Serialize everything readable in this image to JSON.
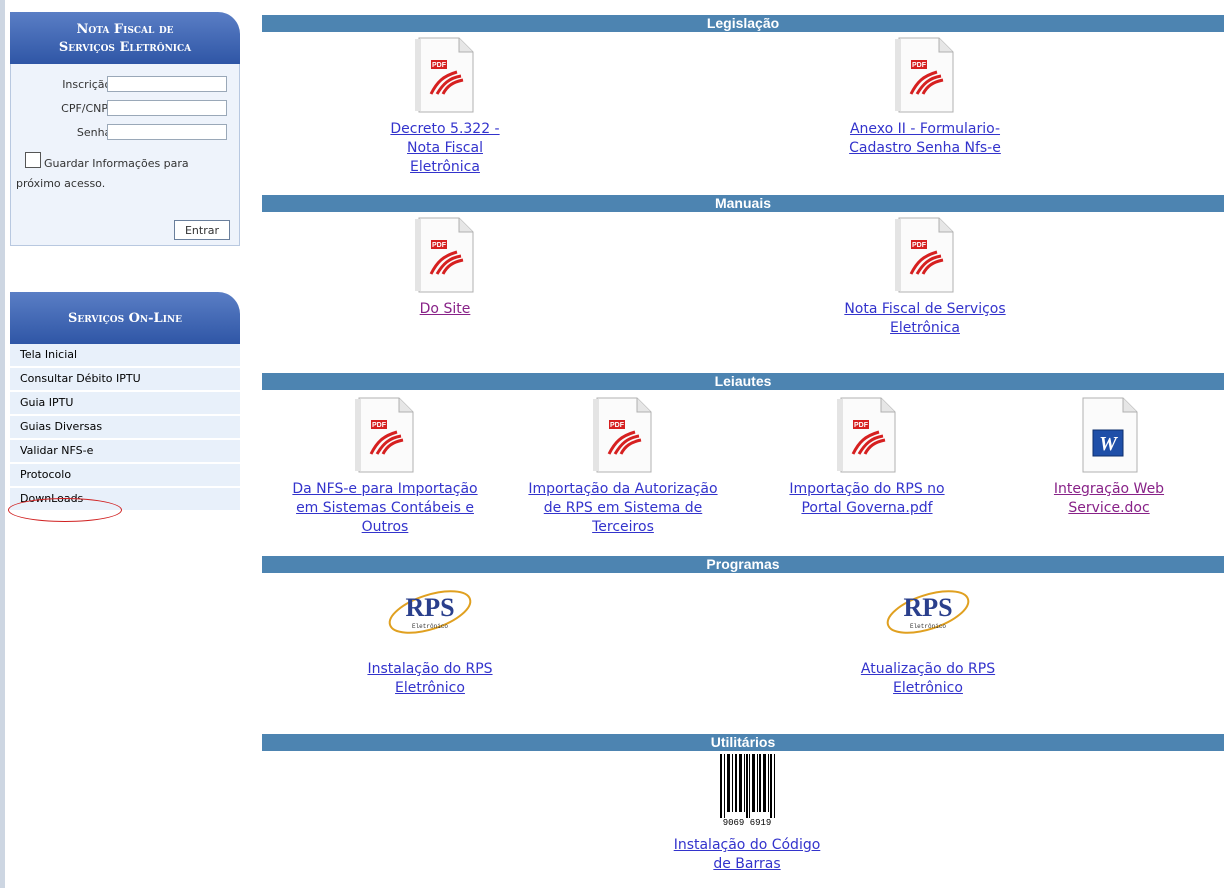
{
  "login": {
    "title_line1": "Nota Fiscal de",
    "title_line2": "Serviços Eletrônica",
    "inscricao_label": "Inscrição:",
    "cpf_label": "CPF/CNPJ:",
    "senha_label": "Senha:",
    "inscricao_value": "",
    "cpf_value": "",
    "senha_value": "",
    "remember_text": "Guardar Informações para próximo acesso.",
    "submit_label": "Entrar"
  },
  "services": {
    "title": "Serviços On-Line",
    "items": [
      "Tela Inicial",
      "Consultar Débito IPTU",
      "Guia IPTU",
      "Guias Diversas",
      "Validar NFS-e",
      "Protocolo",
      "DownLoads"
    ]
  },
  "sections": {
    "legislacao": {
      "title": "Legislação",
      "items": [
        {
          "label": "Decreto 5.322 - Nota Fiscal Eletrônica",
          "icon": "pdf-icon"
        },
        {
          "label": "Anexo II - Formulario-Cadastro Senha Nfs-e",
          "icon": "pdf-icon"
        }
      ]
    },
    "manuais": {
      "title": "Manuais",
      "items": [
        {
          "label": "Do Site",
          "icon": "pdf-icon"
        },
        {
          "label": "Nota Fiscal de Serviços Eletrônica",
          "icon": "pdf-icon"
        }
      ]
    },
    "leiautes": {
      "title": "Leiautes",
      "items": [
        {
          "label": "Da NFS-e para Importação em Sistemas Contábeis e Outros",
          "icon": "pdf-icon"
        },
        {
          "label": "Importação da Autorização de RPS em Sistema de Terceiros",
          "icon": "pdf-icon"
        },
        {
          "label": "Importação do RPS no Portal Governa.pdf",
          "icon": "pdf-icon"
        },
        {
          "label": "Integração Web Service.doc",
          "icon": "word-doc-icon"
        }
      ]
    },
    "programas": {
      "title": "Programas",
      "rps_logo_text": "RPS",
      "rps_logo_sub": "Eletrônico",
      "items": [
        {
          "label": "Instalação do RPS Eletrônico",
          "icon": "rps-logo-icon"
        },
        {
          "label": "Atualização do RPS Eletrônico",
          "icon": "rps-logo-icon"
        }
      ]
    },
    "utilitarios": {
      "title": "Utilitários",
      "barcode_number": "9069 6919",
      "items": [
        {
          "label": "Instalação do Código de Barras",
          "icon": "barcode-icon"
        }
      ]
    }
  },
  "colors": {
    "section_bar": "#4d84b1",
    "panel_header": "#2f56a6",
    "link": "#3333cc",
    "visited_link": "#882288",
    "highlight_oval": "#d02020"
  }
}
